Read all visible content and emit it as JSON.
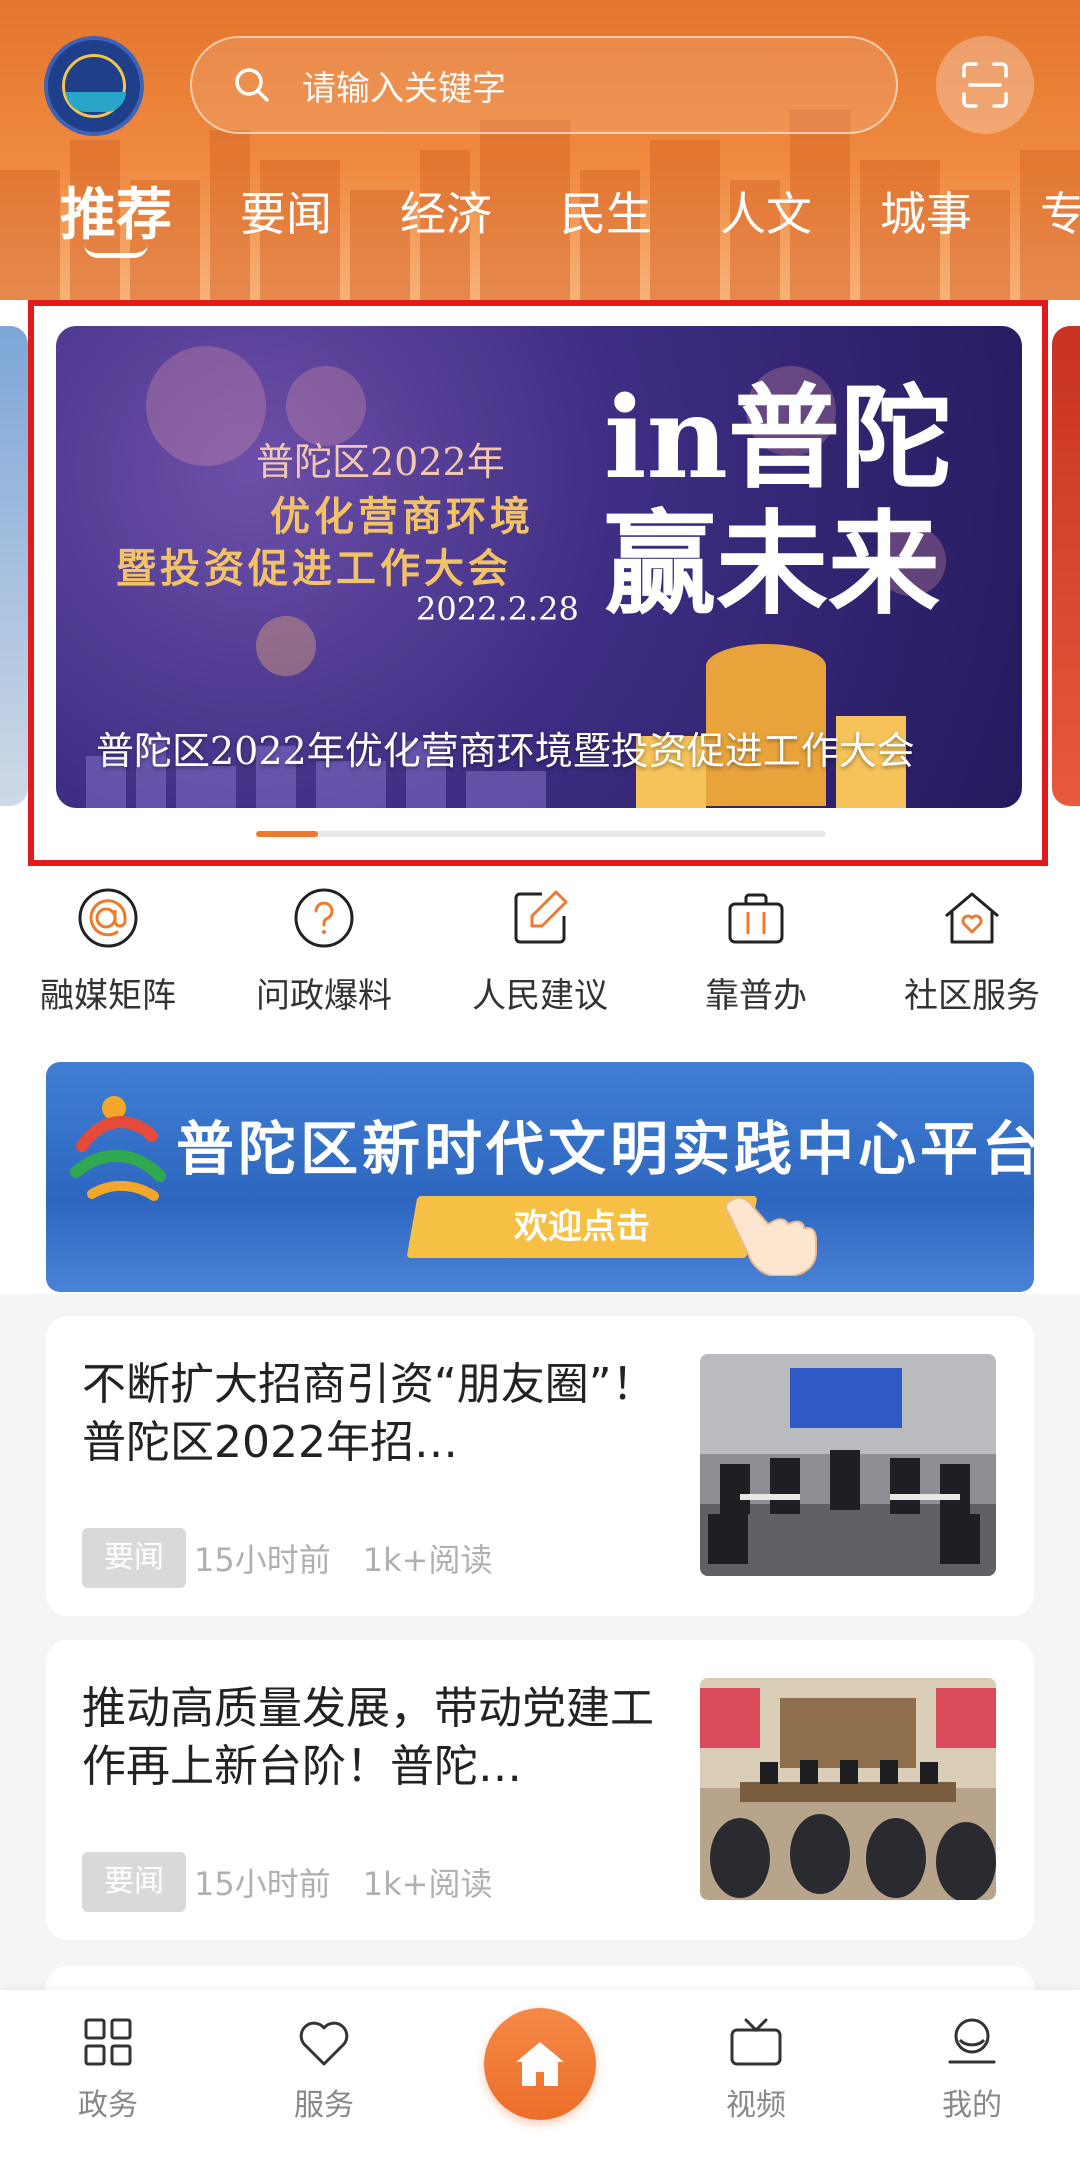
{
  "header": {
    "search_placeholder": "请输入关键字",
    "tabs": [
      "推荐",
      "要闻",
      "经济",
      "民生",
      "人文",
      "城事",
      "专题"
    ]
  },
  "banner": {
    "district_year": "普陀区2022年",
    "line1": "优化营商环境",
    "line2": "暨投资促进工作大会",
    "date": "2022.2.28",
    "slogan_a": "in普陀",
    "slogan_b": "赢未来",
    "caption": "普陀区2022年优化营商环境暨投资促进工作大会"
  },
  "quick_links": [
    {
      "label": "融媒矩阵",
      "icon": "at-icon"
    },
    {
      "label": "问政爆料",
      "icon": "question-icon"
    },
    {
      "label": "人民建议",
      "icon": "edit-icon"
    },
    {
      "label": "靠普办",
      "icon": "briefcase-icon"
    },
    {
      "label": "社区服务",
      "icon": "home-heart-icon"
    }
  ],
  "promo": {
    "title": "普陀区新时代文明实践中心平台",
    "cta": "欢迎点击"
  },
  "news": [
    {
      "headline": "不断扩大招商引资“朋友圈”！普陀区2022年招…",
      "tag": "要闻",
      "time": "15小时前",
      "reads": "1k+阅读"
    },
    {
      "headline": "推动高质量发展，带动党建工作再上新台阶！普陀…",
      "tag": "要闻",
      "time": "15小时前",
      "reads": "1k+阅读"
    }
  ],
  "bottom_nav": [
    {
      "label": "政务",
      "icon": "grid-icon"
    },
    {
      "label": "服务",
      "icon": "heart-icon"
    },
    {
      "label": "",
      "icon": "home-icon"
    },
    {
      "label": "视频",
      "icon": "tv-icon"
    },
    {
      "label": "我的",
      "icon": "profile-icon"
    }
  ],
  "colors": {
    "accent": "#ef7a2f",
    "highlight_frame": "#e01b1b"
  }
}
